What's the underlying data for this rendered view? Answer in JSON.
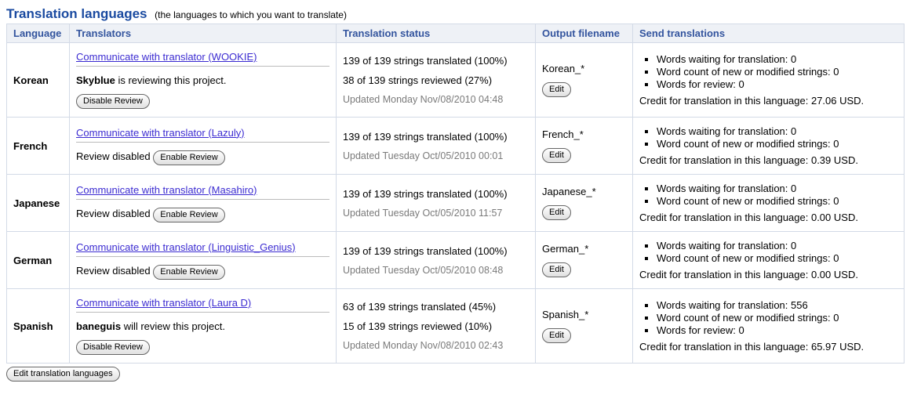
{
  "header": {
    "title": "Translation languages",
    "subtitle": "(the languages to which you want to translate)"
  },
  "columns": {
    "language": "Language",
    "translators": "Translators",
    "status": "Translation status",
    "output": "Output filename",
    "send": "Send translations"
  },
  "labels": {
    "disable_review": "Disable Review",
    "enable_review": "Enable Review",
    "edit": "Edit",
    "words_waiting": "Words waiting for translation: ",
    "word_count_new": "Word count of new or modified strings: ",
    "words_for_review": "Words for review: ",
    "credit_prefix": "Credit for translation in this language: ",
    "review_disabled": "Review disabled",
    "edit_translation_languages": "Edit translation languages"
  },
  "rows": [
    {
      "language": "Korean",
      "translator_link": "Communicate with translator (WOOKIE)",
      "review_mode": "reviewing",
      "reviewer": "Skyblue",
      "review_suffix": " is reviewing this project.",
      "status": [
        "139 of 139 strings translated (100%)",
        "38 of 139 strings reviewed (27%)"
      ],
      "updated": "Updated Monday Nov/08/2010 04:48",
      "output": "Korean_*",
      "waiting": "0",
      "new_modified": "0",
      "for_review": "0",
      "show_for_review": true,
      "credit": "27.06 USD."
    },
    {
      "language": "French",
      "translator_link": "Communicate with translator (Lazuly)",
      "review_mode": "disabled",
      "status": [
        "139 of 139 strings translated (100%)"
      ],
      "updated": "Updated Tuesday Oct/05/2010 00:01",
      "output": "French_*",
      "waiting": "0",
      "new_modified": "0",
      "show_for_review": false,
      "credit": "0.39 USD."
    },
    {
      "language": "Japanese",
      "translator_link": "Communicate with translator (Masahiro)",
      "review_mode": "disabled",
      "status": [
        "139 of 139 strings translated (100%)"
      ],
      "updated": "Updated Tuesday Oct/05/2010 11:57",
      "output": "Japanese_*",
      "waiting": "0",
      "new_modified": "0",
      "show_for_review": false,
      "credit": "0.00 USD."
    },
    {
      "language": "German",
      "translator_link": "Communicate with translator (Linguistic_Genius)",
      "review_mode": "disabled",
      "status": [
        "139 of 139 strings translated (100%)"
      ],
      "updated": "Updated Tuesday Oct/05/2010 08:48",
      "output": "German_*",
      "waiting": "0",
      "new_modified": "0",
      "show_for_review": false,
      "credit": "0.00 USD."
    },
    {
      "language": "Spanish",
      "translator_link": "Communicate with translator (Laura D)",
      "review_mode": "willreview",
      "reviewer": "baneguis",
      "review_suffix": " will review this project.",
      "status": [
        "63 of 139 strings translated (45%)",
        "15 of 139 strings reviewed (10%)"
      ],
      "updated": "Updated Monday Nov/08/2010 02:43",
      "output": "Spanish_*",
      "waiting": "556",
      "new_modified": "0",
      "for_review": "0",
      "show_for_review": true,
      "credit": "65.97 USD."
    }
  ]
}
